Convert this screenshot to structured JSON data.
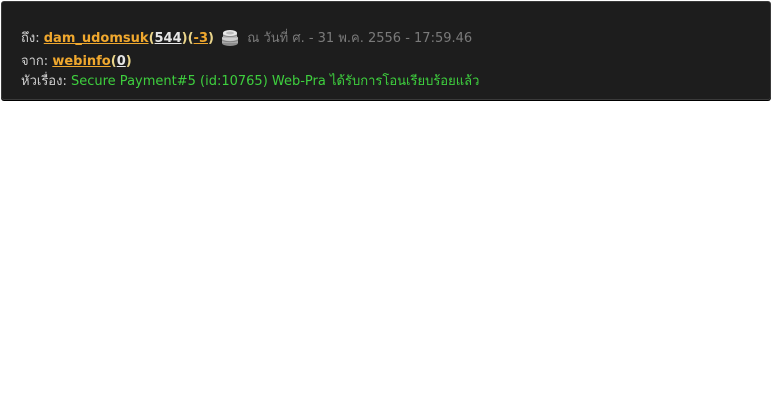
{
  "to": {
    "label": "ถึง:",
    "username": "dam_udomsuk",
    "paren_open": "(",
    "score": "544",
    "paren_mid": ")(",
    "negative": "-3",
    "paren_close": ")",
    "badge_icon": "silver-coin-stack-icon",
    "date": "ณ วันที่ ศ. - 31 พ.ค. 2556 - 17:59.46"
  },
  "from": {
    "label": "จาก:",
    "username": "webinfo",
    "paren_open": "(",
    "score": "0",
    "paren_close": ")"
  },
  "subject": {
    "label": "หัวเรื่อง:",
    "text": "Secure Payment#5 (id:10765) Web-Pra ได้รับการโอนเรียบร้อยแล้ว"
  },
  "colors": {
    "background": "#1d1d1d",
    "username": "#f0a82e",
    "subject": "#3ecf3e",
    "date": "#7a7a7a"
  }
}
